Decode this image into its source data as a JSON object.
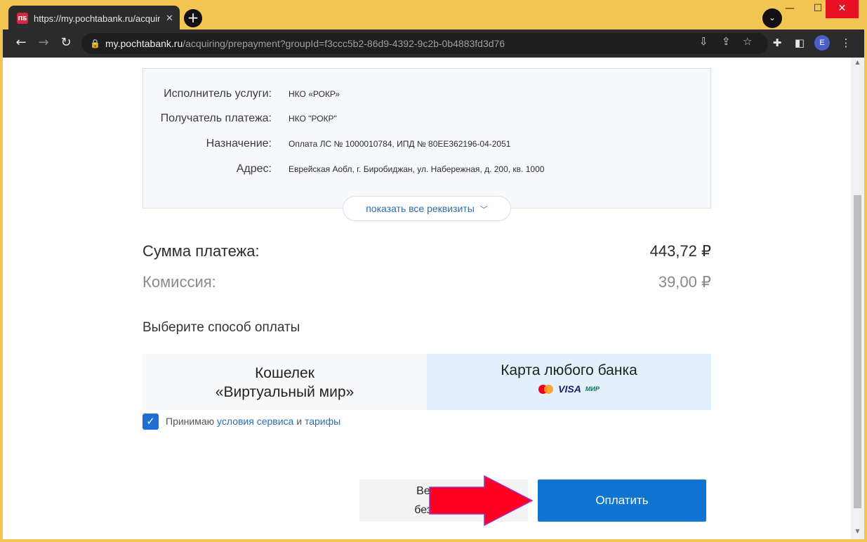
{
  "browser": {
    "tab_title": "https://my.pochtabank.ru/acquiring",
    "tab_favicon_text": "ПБ",
    "url_host": "my.pochtabank.ru",
    "url_path": "/acquiring/prepayment?groupId=f3ccc5b2-86d9-4392-9c2b-0b4883fd3d76",
    "profile_initial": "E"
  },
  "details": {
    "rows": [
      {
        "label": "Исполнитель услуги:",
        "value": "НКО «РОКР»"
      },
      {
        "label": "Получатель платежа:",
        "value": "НКО \"РОКР\""
      },
      {
        "label": "Назначение:",
        "value": "Оплата ЛС № 1000010784, ИПД № 80EE362196-04-2051"
      },
      {
        "label": "Адрес:",
        "value": "Еврейская Аобл, г. Биробиджан, ул. Набережная, д. 200, кв. 1000"
      }
    ],
    "show_all_label": "показать все реквизиты"
  },
  "payment": {
    "sum_label": "Сумма платежа:",
    "sum_value": "443,72 ₽",
    "fee_label": "Комиссия:",
    "fee_value": "39,00 ₽"
  },
  "methods": {
    "title": "Выберите способ оплаты",
    "wallet_line1": "Кошелек",
    "wallet_line2": "«Виртуальный мир»",
    "card_label": "Карта любого банка",
    "card_logos": {
      "visa": "VISA",
      "mir": "МИР"
    },
    "selected": "card"
  },
  "agreement": {
    "checked": true,
    "prefix": "Принимаю ",
    "terms_link": "условия сервиса",
    "and": " и ",
    "tariffs_link": "тарифы"
  },
  "buttons": {
    "back_line1": "Вернуться",
    "back_line2": "без оплаты",
    "pay_label": "Оплатить"
  },
  "colors": {
    "accent": "#0f74d2",
    "selected_method_bg": "#e3f0fc",
    "annotation_arrow": "#ff0022"
  }
}
